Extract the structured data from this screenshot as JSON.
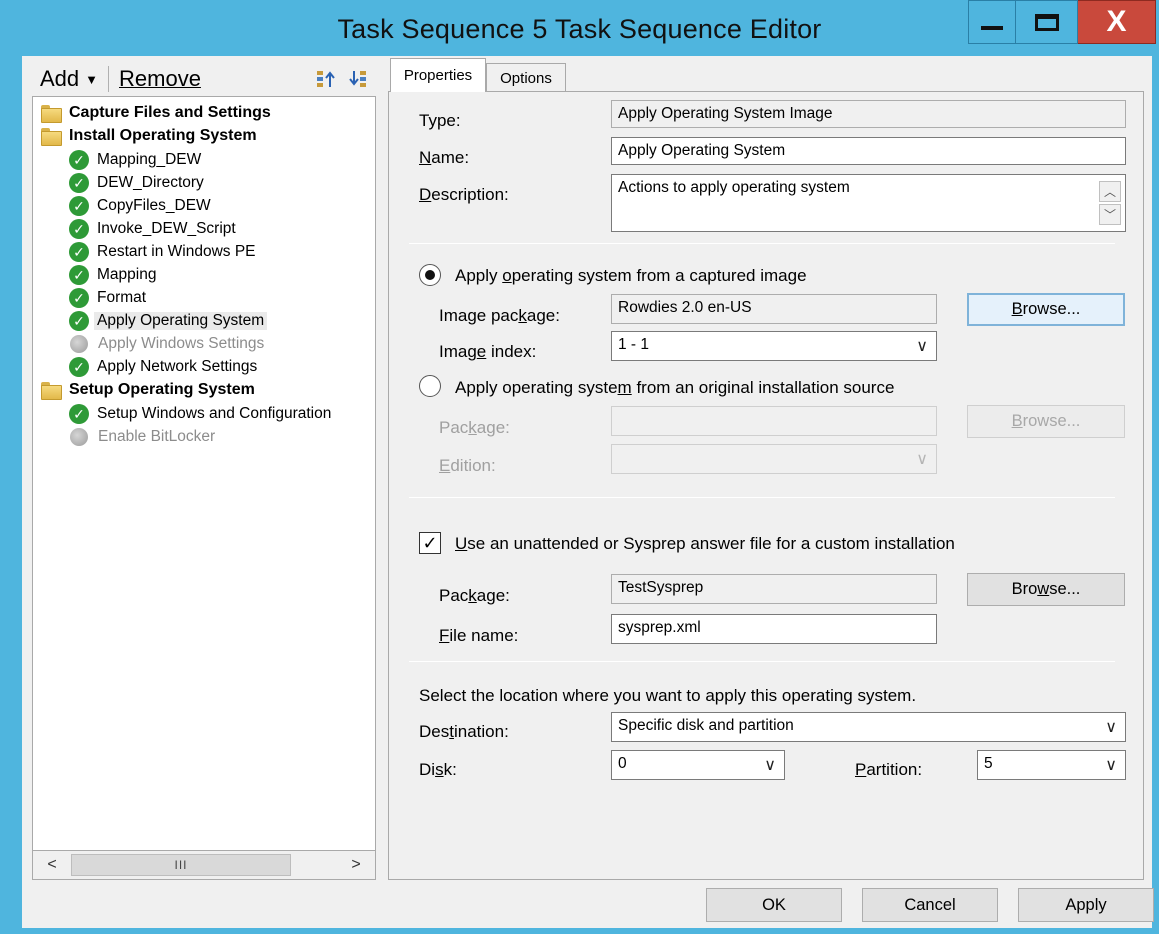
{
  "window": {
    "title": "Task Sequence 5 Task Sequence Editor",
    "minimize_label": "",
    "maximize_label": "",
    "close_label": "X"
  },
  "toolbar": {
    "add_label": "Add",
    "remove_label": "Remove"
  },
  "tree": {
    "groups": [
      {
        "label": "Capture Files and Settings"
      },
      {
        "label": "Install Operating System"
      },
      {
        "label": "Setup Operating System"
      }
    ],
    "items": [
      {
        "label": "Mapping_DEW",
        "status": "enabled"
      },
      {
        "label": "DEW_Directory",
        "status": "enabled"
      },
      {
        "label": "CopyFiles_DEW",
        "status": "enabled"
      },
      {
        "label": "Invoke_DEW_Script",
        "status": "enabled"
      },
      {
        "label": "Restart in Windows PE",
        "status": "enabled"
      },
      {
        "label": "Mapping",
        "status": "enabled"
      },
      {
        "label": "Format",
        "status": "enabled"
      },
      {
        "label": "Apply Operating System",
        "status": "enabled",
        "selected": true
      },
      {
        "label": "Apply Windows Settings",
        "status": "disabled"
      },
      {
        "label": "Apply Network Settings",
        "status": "enabled"
      },
      {
        "label": "Setup Windows and Configuration",
        "status": "enabled"
      },
      {
        "label": "Enable BitLocker",
        "status": "disabled"
      }
    ],
    "scroll_thumb_label": "III"
  },
  "tabs": {
    "properties": "Properties",
    "options": "Options"
  },
  "properties": {
    "type_label": "Type:",
    "type_value": "Apply Operating System Image",
    "name_label": "Name:",
    "name_value": "Apply Operating System",
    "description_label": "Description:",
    "description_value": "Actions to apply operating system",
    "radio_captured_label": "Apply operating system from a captured image",
    "image_package_label": "Image package:",
    "image_package_value": "Rowdies 2.0 en-US",
    "browse_label": "Browse...",
    "image_index_label": "Image index:",
    "image_index_value": "1 - 1",
    "radio_original_label": "Apply operating system from an original installation source",
    "orig_package_label": "Package:",
    "orig_package_value": "",
    "orig_browse_label": "Browse...",
    "edition_label": "Edition:",
    "edition_value": "",
    "unattend_label": "Use an unattended or Sysprep answer file for a custom installation",
    "unattend_checked": true,
    "sysprep_package_label": "Package:",
    "sysprep_package_value": "TestSysprep",
    "sysprep_browse_label": "Browse...",
    "file_name_label": "File name:",
    "file_name_value": "sysprep.xml",
    "location_text": "Select the location where you want to apply this operating system.",
    "destination_label": "Destination:",
    "destination_value": "Specific disk and partition",
    "disk_label": "Disk:",
    "disk_value": "0",
    "partition_label": "Partition:",
    "partition_value": "5"
  },
  "footer": {
    "ok": "OK",
    "cancel": "Cancel",
    "apply": "Apply"
  }
}
